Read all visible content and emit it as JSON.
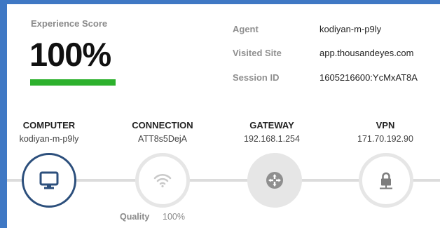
{
  "score": {
    "label": "Experience Score",
    "value": "100%",
    "fraction": 1.0,
    "bar_color": "#2db12d"
  },
  "meta": [
    {
      "label": "Agent",
      "value": "kodiyan-m-p9ly"
    },
    {
      "label": "Visited Site",
      "value": "app.thousandeyes.com"
    },
    {
      "label": "Session ID",
      "value": "1605216600:YcMxAT8A"
    }
  ],
  "nodes": {
    "computer": {
      "title": "COMPUTER",
      "sub": "kodiyan-m-p9ly",
      "icon": "monitor-icon"
    },
    "connection": {
      "title": "CONNECTION",
      "sub": "ATT8s5DejA",
      "icon": "wifi-icon"
    },
    "gateway": {
      "title": "GATEWAY",
      "sub": "192.168.1.254",
      "icon": "router-icon"
    },
    "vpn": {
      "title": "VPN",
      "sub": "171.70.192.90",
      "icon": "lock-icon"
    }
  },
  "quality": {
    "label": "Quality",
    "value": "100%"
  },
  "colors": {
    "accent": "#2c4f7c",
    "background": "#3f78c4",
    "line": "#dcdcdc"
  }
}
